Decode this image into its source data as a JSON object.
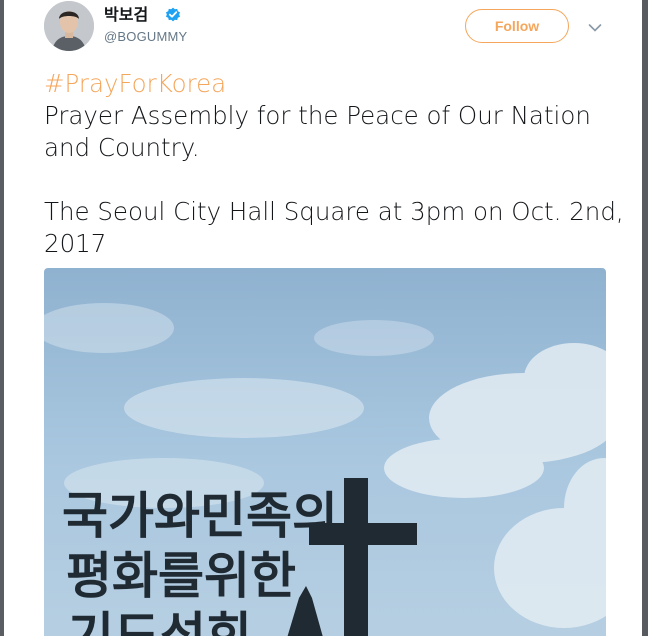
{
  "header": {
    "display_name": "박보검",
    "handle": "@BOGUMMY",
    "follow_label": "Follow",
    "verified_icon": "verified-badge-icon",
    "menu_icon": "chevron-down-icon"
  },
  "tweet": {
    "hashtag": "#PrayForKorea",
    "line1": "Prayer Assembly for the Peace of Our Nation and Country.",
    "line2": "The Seoul City Hall Square at 3pm on Oct. 2nd, 2017"
  },
  "photo": {
    "sign_row1": "국가와민족의",
    "sign_row2": "평화를위한",
    "sign_row3": "기도성회"
  },
  "colors": {
    "accent": "#f5a65b",
    "verified": "#1da1f2",
    "text": "#14171a",
    "secondary_text": "#657786"
  }
}
